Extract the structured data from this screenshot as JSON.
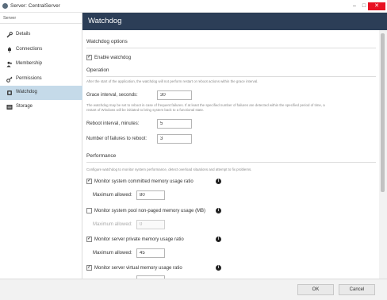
{
  "window": {
    "title": "Server: CentralServer"
  },
  "sidebar": {
    "section_label": "Server",
    "items": [
      {
        "label": "Details",
        "icon": "wrench-icon"
      },
      {
        "label": "Connections",
        "icon": "plug-icon"
      },
      {
        "label": "Membership",
        "icon": "users-icon"
      },
      {
        "label": "Permissions",
        "icon": "key-icon"
      },
      {
        "label": "Watchdog",
        "icon": "watchdog-icon",
        "active": true
      },
      {
        "label": "Storage",
        "icon": "storage-icon"
      }
    ]
  },
  "header": {
    "title": "Watchdog"
  },
  "watchdog": {
    "section_title": "Watchdog options",
    "enable_label": "Enable watchdog",
    "operation_title": "Operation",
    "operation_desc": "After the start of the application, the watchdog will not perform restart or reboot actions within the grace interval.",
    "grace_label": "Grace interval, seconds:",
    "grace_value": "30",
    "reboot_desc": "The watchdog may be set to reboot in case of frequent failures. If at least the specified number of failures are detected within the specified period of time, a restart of Windows will be initiated to bring system back to a functional state.",
    "reboot_interval_label": "Reboot interval, minutes:",
    "reboot_interval_value": "5",
    "failures_label": "Number of failures to reboot:",
    "failures_value": "3"
  },
  "performance": {
    "section_title": "Performance",
    "desc": "Configure watchdog to monitor system performance, detect overload situations and attempt to fix problems.",
    "max_allowed_label": "Maximum allowed:",
    "monitors": [
      {
        "label": "Monitor system committed memory usage ratio",
        "checked": true,
        "value": "80",
        "enabled": true
      },
      {
        "label": "Monitor system pool non-paged memory usage (MB)",
        "checked": false,
        "value": "0",
        "enabled": false
      },
      {
        "label": "Monitor server private memory usage ratio",
        "checked": true,
        "value": "45",
        "enabled": true
      },
      {
        "label": "Monitor server virtual memory usage ratio",
        "checked": true,
        "value": "",
        "enabled": true
      }
    ]
  },
  "footer": {
    "ok_label": "OK",
    "cancel_label": "Cancel"
  }
}
